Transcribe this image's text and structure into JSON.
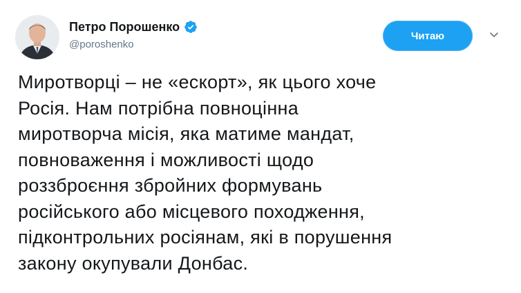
{
  "user": {
    "display_name": "Петро Порошенко",
    "handle": "@poroshenko",
    "verified": true
  },
  "follow_button": {
    "label": "Читаю"
  },
  "menu": {
    "icon": "chevron-down-icon"
  },
  "tweet": {
    "text": "Миротворці – не «ескорт», як цього хоче\nРосія. Нам потрібна повноцінна\nмиротворча місія, яка матиме мандат,\nповноваження і можливості щодо\nроззброєння збройних формувань\nросійського або місцевого походження,\nпідконтрольних росіянам, які в порушення\nзакону окупували Донбас."
  },
  "colors": {
    "accent": "#1da1f2",
    "text": "#14171a",
    "secondary": "#657786"
  }
}
